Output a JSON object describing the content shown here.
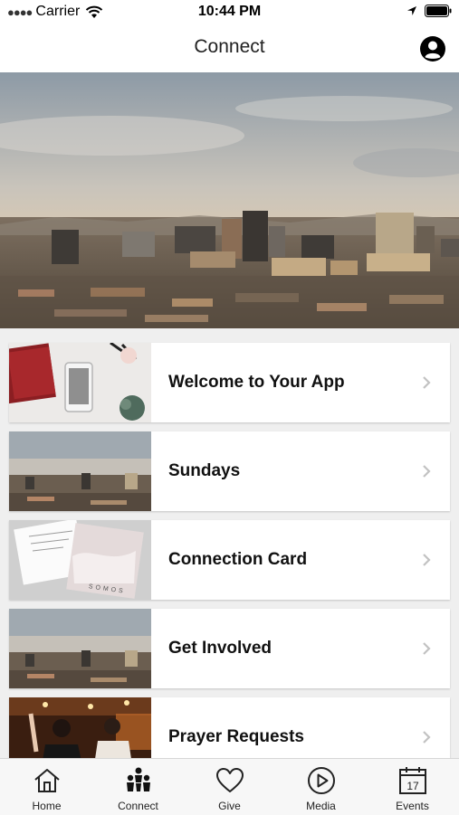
{
  "status_bar": {
    "carrier": "Carrier",
    "time": "10:44 PM"
  },
  "nav": {
    "title": "Connect",
    "profile_icon": "person-circle-icon"
  },
  "cards": [
    {
      "label": "Welcome to Your App",
      "thumb": "desk-phone"
    },
    {
      "label": "Sundays",
      "thumb": "city-skyline"
    },
    {
      "label": "Connection Card",
      "thumb": "somos-cards"
    },
    {
      "label": "Get Involved",
      "thumb": "city-skyline"
    },
    {
      "label": "Prayer Requests",
      "thumb": "worship"
    }
  ],
  "tabs": [
    {
      "label": "Home",
      "icon": "house-icon"
    },
    {
      "label": "Connect",
      "icon": "people-icon"
    },
    {
      "label": "Give",
      "icon": "heart-icon"
    },
    {
      "label": "Media",
      "icon": "play-circle-icon"
    },
    {
      "label": "Events",
      "icon": "calendar-icon"
    }
  ],
  "calendar_day": "17",
  "thumb_lettering": "SOMOS"
}
